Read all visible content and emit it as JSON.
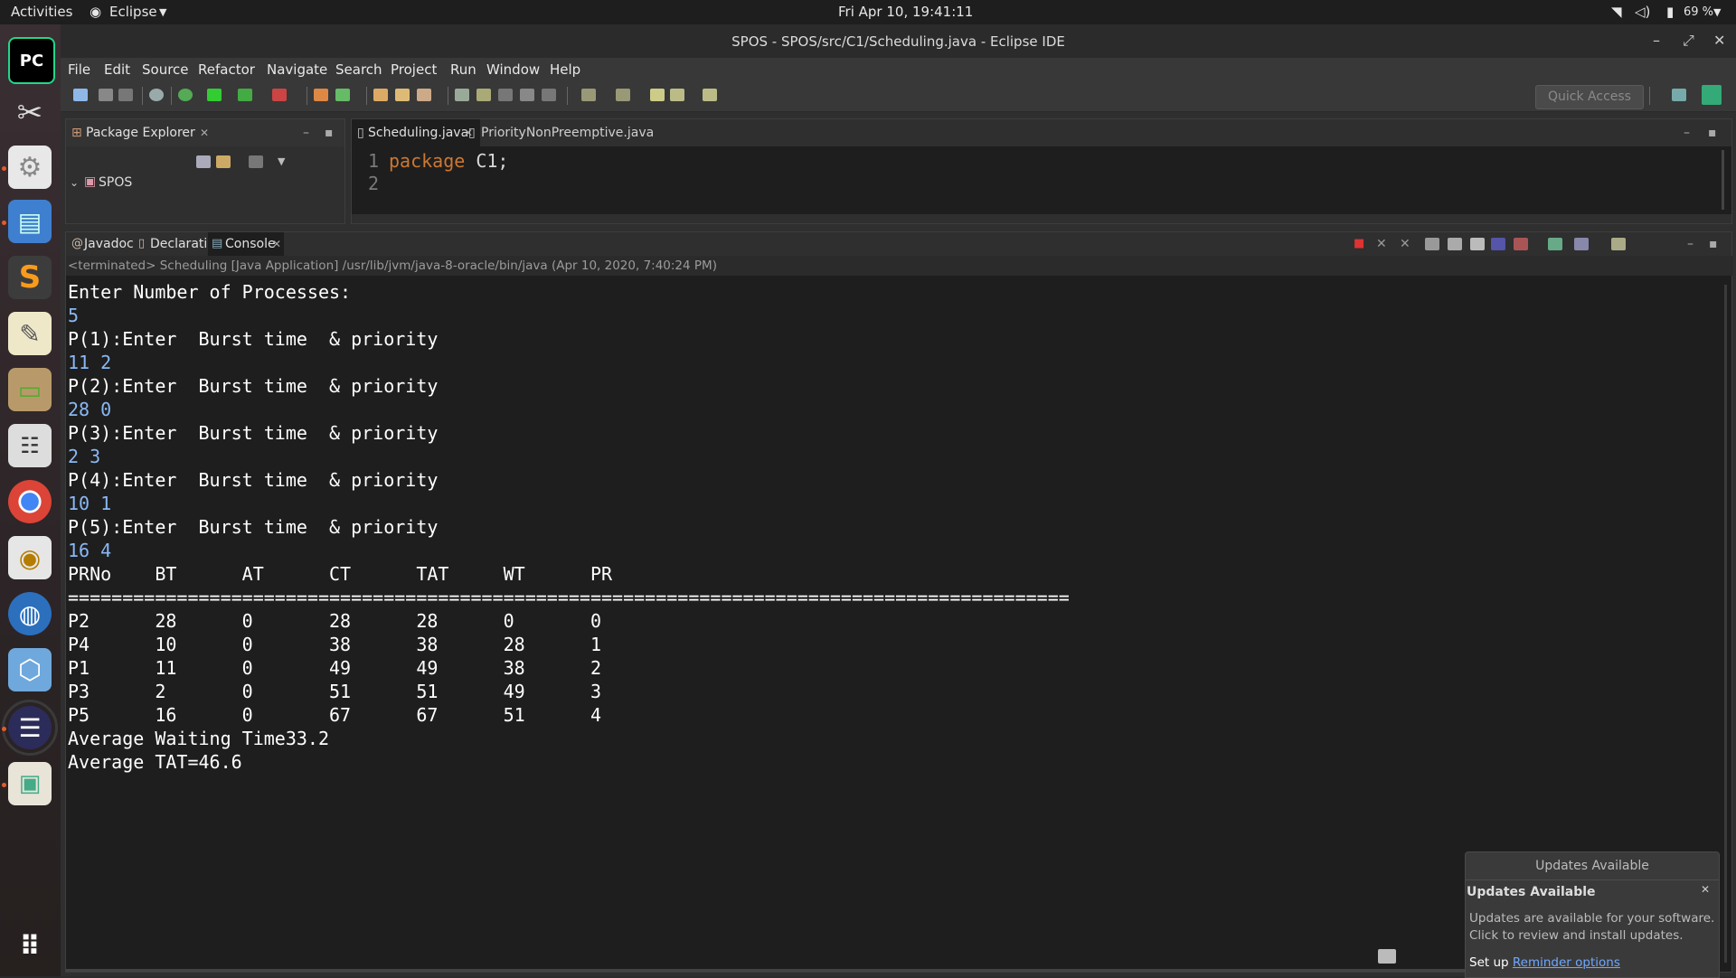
{
  "topbar": {
    "activities": "Activities",
    "app_menu": "Eclipse",
    "clock": "Fri Apr 10, 19:41:11",
    "battery": "69 %"
  },
  "window": {
    "title": "SPOS - SPOS/src/C1/Scheduling.java - Eclipse IDE"
  },
  "menu": [
    "File",
    "Edit",
    "Source",
    "Refactor",
    "Navigate",
    "Search",
    "Project",
    "Run",
    "Window",
    "Help"
  ],
  "toolbar": {
    "quick_access_placeholder": "Quick Access"
  },
  "package_explorer": {
    "tab_label": "Package Explorer",
    "project": "SPOS"
  },
  "editor": {
    "tabs": [
      "Scheduling.java",
      "PriorityNonPreemptive.java"
    ],
    "line_numbers": [
      "1",
      "2"
    ],
    "keyword": "package",
    "package_name": " C1;"
  },
  "bottom_tabs": [
    "Javadoc",
    "Declaration",
    "Console"
  ],
  "console": {
    "terminated_line": "<terminated> Scheduling [Java Application] /usr/lib/jvm/java-8-oracle/bin/java (Apr 10, 2020, 7:40:24 PM)",
    "prompt_processes": "Enter Number of Processes:",
    "num_processes": "5",
    "prompts": [
      {
        "prompt": "P(1):Enter  Burst time  & priority",
        "input": "11 2"
      },
      {
        "prompt": "P(2):Enter  Burst time  & priority",
        "input": "28 0"
      },
      {
        "prompt": "P(3):Enter  Burst time  & priority",
        "input": "2 3"
      },
      {
        "prompt": "P(4):Enter  Burst time  & priority",
        "input": "10 1"
      },
      {
        "prompt": "P(5):Enter  Burst time  & priority",
        "input": "16 4"
      }
    ],
    "table_header": [
      "PRNo",
      "BT",
      "AT",
      "CT",
      "TAT",
      "WT",
      "PR"
    ],
    "separator": "============================================================================================",
    "rows": [
      [
        "P2",
        "28",
        "0",
        "28",
        "28",
        "0",
        "0"
      ],
      [
        "P4",
        "10",
        "0",
        "38",
        "38",
        "28",
        "1"
      ],
      [
        "P1",
        "11",
        "0",
        "49",
        "49",
        "38",
        "2"
      ],
      [
        "P3",
        "2",
        "0",
        "51",
        "51",
        "49",
        "3"
      ],
      [
        "P5",
        "16",
        "0",
        "67",
        "67",
        "51",
        "4"
      ]
    ],
    "avg_wt": "Average Waiting Time33.2",
    "avg_tat": "Average TAT=46.6"
  },
  "notification": {
    "header": "Updates Available",
    "title": "Updates Available",
    "body_line1": "Updates are available for your software.",
    "body_line2": "Click to review and install updates.",
    "setup_prefix": "Set up ",
    "setup_link": "Reminder options"
  }
}
